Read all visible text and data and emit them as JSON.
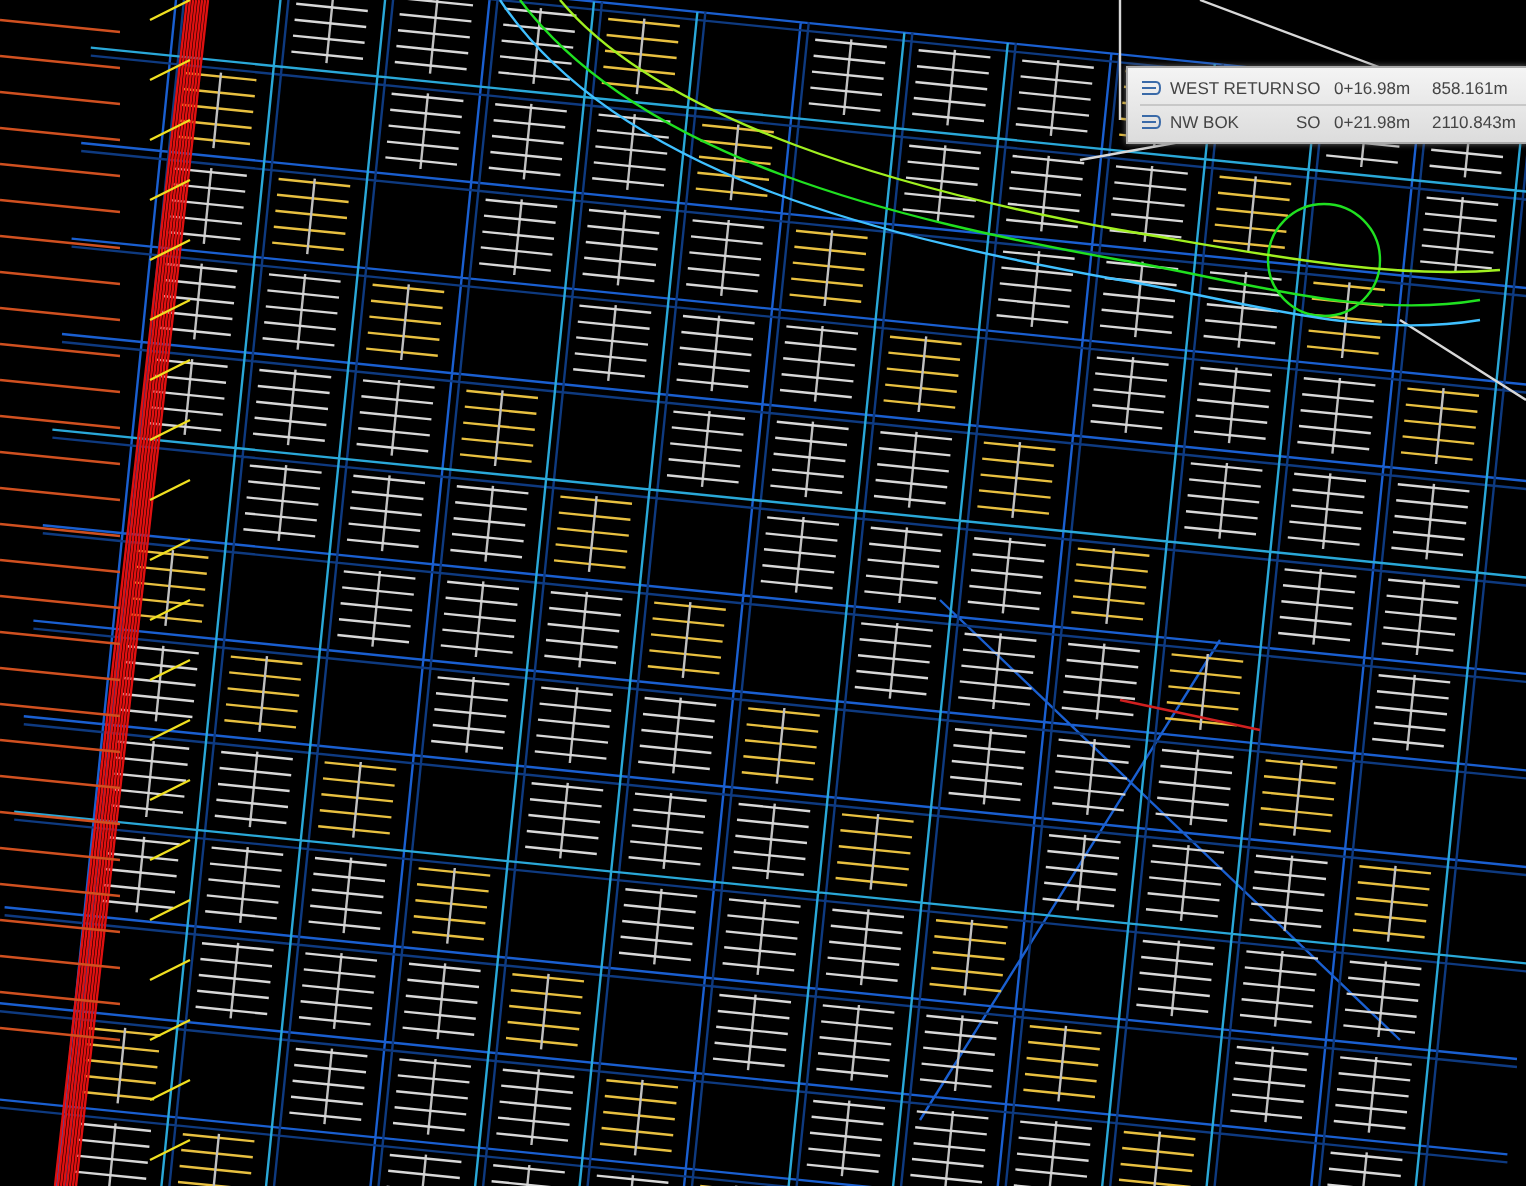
{
  "alignments": [
    {
      "name": "WEST RETURN",
      "side": "SO",
      "station": "0+16.98m",
      "length": "858.161m"
    },
    {
      "name": "NW BOK",
      "side": "SO",
      "station": "0+21.98m",
      "length": "2110.843m"
    }
  ]
}
